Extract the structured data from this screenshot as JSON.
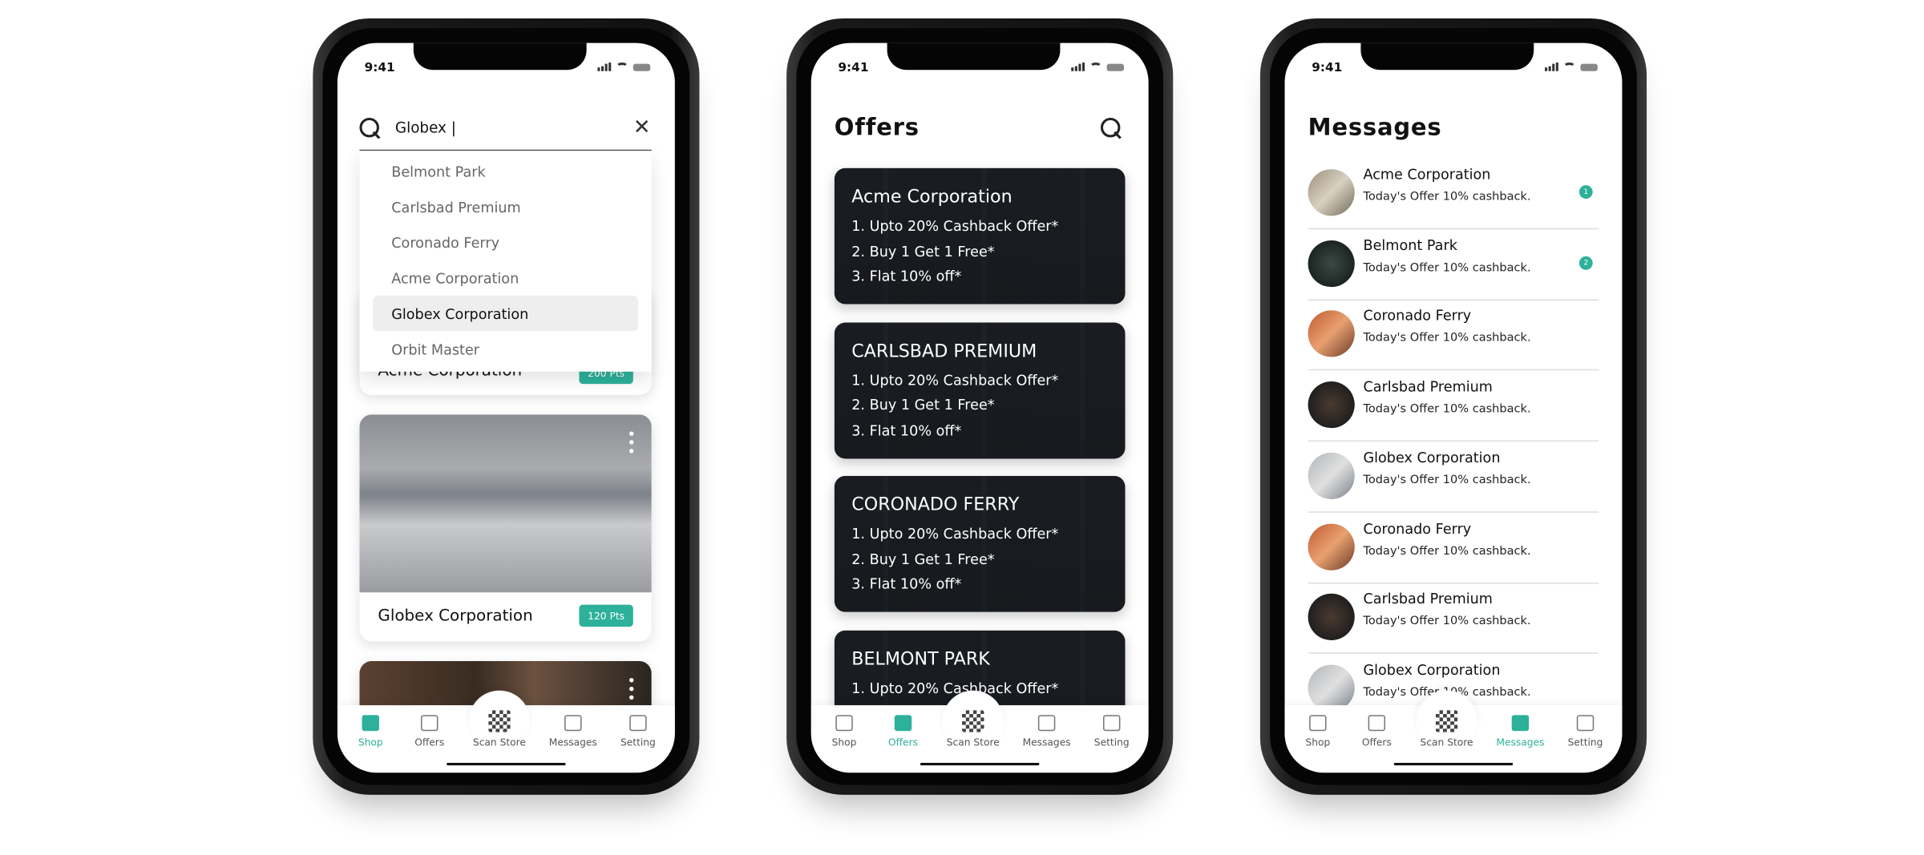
{
  "colors": {
    "accent": "#2db19a"
  },
  "status_time": "9:41",
  "tabs": [
    {
      "label": "Shop",
      "icon": "shopping-bag-icon"
    },
    {
      "label": "Offers",
      "icon": "coupon-icon"
    },
    {
      "label": "Scan Store",
      "icon": "qr-code-icon"
    },
    {
      "label": "Messages",
      "icon": "chat-icon"
    },
    {
      "label": "Setting",
      "icon": "gear-icon"
    }
  ],
  "shop": {
    "active_tab": "Shop",
    "search_value": "Globex |",
    "suggestions": [
      "Belmont Park",
      "Carlsbad Premium",
      "Coronado Ferry",
      "Acme Corporation",
      "Globex Corporation",
      "Orbit Master"
    ],
    "selected_suggestion": "Globex Corporation",
    "cards": [
      {
        "name": "Acme Corporation",
        "points": "200 Pts"
      },
      {
        "name": "Globex Corporation",
        "points": "120 Pts"
      }
    ]
  },
  "offers": {
    "active_tab": "Offers",
    "title": "Offers",
    "cards": [
      {
        "title": "Acme Corporation",
        "lines": [
          "1. Upto 20% Cashback Offer*",
          "2. Buy 1 Get 1 Free*",
          "3. Flat 10% off*"
        ]
      },
      {
        "title": "CARLSBAD PREMIUM",
        "lines": [
          "1. Upto 20% Cashback Offer*",
          "2. Buy 1 Get 1 Free*",
          "3. Flat 10% off*"
        ]
      },
      {
        "title": "CORONADO FERRY",
        "lines": [
          "1. Upto 20% Cashback Offer*",
          "2. Buy 1 Get 1 Free*",
          "3. Flat 10% off*"
        ]
      },
      {
        "title": "BELMONT PARK",
        "lines": [
          "1. Upto 20% Cashback Offer*"
        ]
      }
    ]
  },
  "messages": {
    "active_tab": "Messages",
    "title": "Messages",
    "items": [
      {
        "name": "Acme Corporation",
        "text": "Today's Offer 10% cashback.",
        "unread": "1"
      },
      {
        "name": "Belmont Park",
        "text": "Today's Offer 10% cashback.",
        "unread": "2"
      },
      {
        "name": "Coronado Ferry",
        "text": "Today's Offer 10% cashback."
      },
      {
        "name": "Carlsbad Premium",
        "text": "Today's Offer 10% cashback."
      },
      {
        "name": "Globex Corporation",
        "text": "Today's Offer 10% cashback."
      },
      {
        "name": "Coronado Ferry",
        "text": "Today's Offer 10% cashback."
      },
      {
        "name": "Carlsbad Premium",
        "text": "Today's Offer 10% cashback."
      },
      {
        "name": "Globex Corporation",
        "text": "Today's Offer 10% cashback."
      }
    ]
  }
}
